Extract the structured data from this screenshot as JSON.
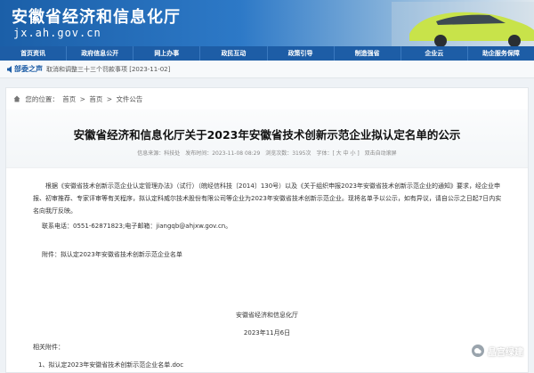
{
  "header": {
    "site_title": "安徽省经济和信息化厅",
    "domain": "jx.ah.gov.cn"
  },
  "nav": {
    "items": [
      "首页资讯",
      "政府信息公开",
      "网上办事",
      "政民互动",
      "政策引导",
      "制造强省",
      "企业云",
      "助企服务保障"
    ]
  },
  "announce": {
    "label": "部委之声",
    "item": "取消和调整三十三个罚款事项 [2023-11-02]"
  },
  "breadcrumb": {
    "prefix": "您的位置：",
    "items": [
      "首页",
      ">",
      "首页",
      ">",
      "文件公告"
    ]
  },
  "article": {
    "title": "安徽省经济和信息化厅关于2023年安徽省技术创新示范企业拟认定名单的公示",
    "meta": {
      "source": "信息来源：科技处",
      "date": "发布时间：2023-11-08 08:29",
      "views": "浏览次数：3195次",
      "font_size": "字体：[ 大 中 小 ]",
      "close": "双击自动滚屏"
    },
    "paragraph": "根据《安徽省技术创新示范企业认定管理办法》（试行）（皖经信科技〔2014〕130号）以及《关于组织申报2023年安徽省技术创新示范企业的通知》要求，经企业申报、初审推荐、专家评审等有关程序，拟认定科威尔技术股份有限公司等企业为2023年安徽省技术创新示范企业。现将名单予以公示，如有异议，请自公示之日起7日内实名向我厅反映。",
    "contact": "联系电话：0551-62871823;电子邮箱：jiangqb@ahjxw.gov.cn。",
    "attachment": "附件：拟认定2023年安徽省技术创新示范企业名单",
    "signer_org": "安徽省经济和信息化厅",
    "signer_date": "2023年11月6日",
    "related_label": "相关附件：",
    "related_item": "1、拟认定2023年安徽省技术创新示范企业名单.doc"
  },
  "watermark": {
    "text": "晶宫绿建"
  }
}
